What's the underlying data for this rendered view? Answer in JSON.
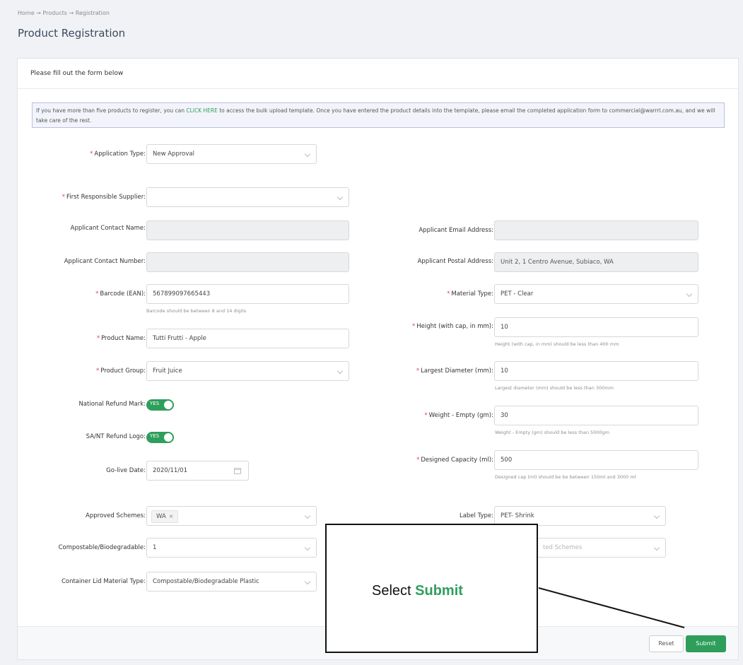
{
  "breadcrumb": "Home → Products → Registration",
  "page_title": "Product Registration",
  "form_header": "Please fill out the form below",
  "info": {
    "before": "If you have more than five products to register, you can ",
    "link": "CLICK HERE",
    "after": " to access the bulk upload template. Once you have entered the product details into the template, please email the completed application form to commercial@warrrl.com.au, and we will take care of the rest."
  },
  "fields": {
    "application_type": {
      "label": "Application Type:",
      "value": "New Approval"
    },
    "first_supplier": {
      "label": "First Responsible Supplier:",
      "value": ""
    },
    "contact_name": {
      "label": "Applicant Contact Name:",
      "value": ""
    },
    "contact_number": {
      "label": "Applicant Contact Number:",
      "value": ""
    },
    "email": {
      "label": "Applicant Email Address:",
      "value": ""
    },
    "postal": {
      "label": "Applicant Postal Address:",
      "value": "Unit 2, 1 Centro Avenue, Subiaco, WA"
    },
    "barcode": {
      "label": "Barcode (EAN):",
      "value": "567899097665443",
      "hint": "Barcode should be between 8 and 14 digits"
    },
    "material": {
      "label": "Material Type:",
      "value": "PET - Clear"
    },
    "height": {
      "label": "Height (with cap, in mm):",
      "value": "10",
      "hint": "Height (with cap, in mm) should be less than 400 mm"
    },
    "product_name": {
      "label": "Product Name:",
      "value": "Tutti Frutti - Apple"
    },
    "product_group": {
      "label": "Product Group:",
      "value": "Fruit Juice"
    },
    "diameter": {
      "label": "Largest Diameter (mm):",
      "value": "10",
      "hint": "Largest diameter (mm) should be less than 300mm"
    },
    "national_refund": {
      "label": "National Refund Mark:",
      "toggle": "YES"
    },
    "weight": {
      "label": "Weight - Empty (gm):",
      "value": "30",
      "hint": "Weight - Empty (gm) should be less than 5000gm"
    },
    "sant_refund": {
      "label": "SA/NT Refund Logo:",
      "toggle": "YES"
    },
    "go_live": {
      "label": "Go-live Date:",
      "value": "2020/11/01"
    },
    "capacity": {
      "label": "Designed Capacity (ml):",
      "value": "500",
      "hint": "Designed cap (ml) should be be between 150ml and 3000 ml"
    },
    "schemes": {
      "label": "Approved Schemes:",
      "tag": "WA",
      "tag_close": "×"
    },
    "label_type": {
      "label": "Label Type:",
      "value": "PET- Shrink"
    },
    "compostable": {
      "label": "Compostable/Biodegradable:",
      "value": "1"
    },
    "related_schemes": {
      "value": "ted Schemes"
    },
    "lid_material": {
      "label": "Container Lid Material Type:",
      "value": "Compostable/Biodegradable Plastic"
    }
  },
  "required_mark": "*",
  "buttons": {
    "reset": "Reset",
    "submit": "Submit"
  },
  "callout": {
    "prefix": "Select ",
    "emphasis": "Submit"
  },
  "colors": {
    "accent": "#2e9e5b",
    "required": "#e0464f"
  }
}
